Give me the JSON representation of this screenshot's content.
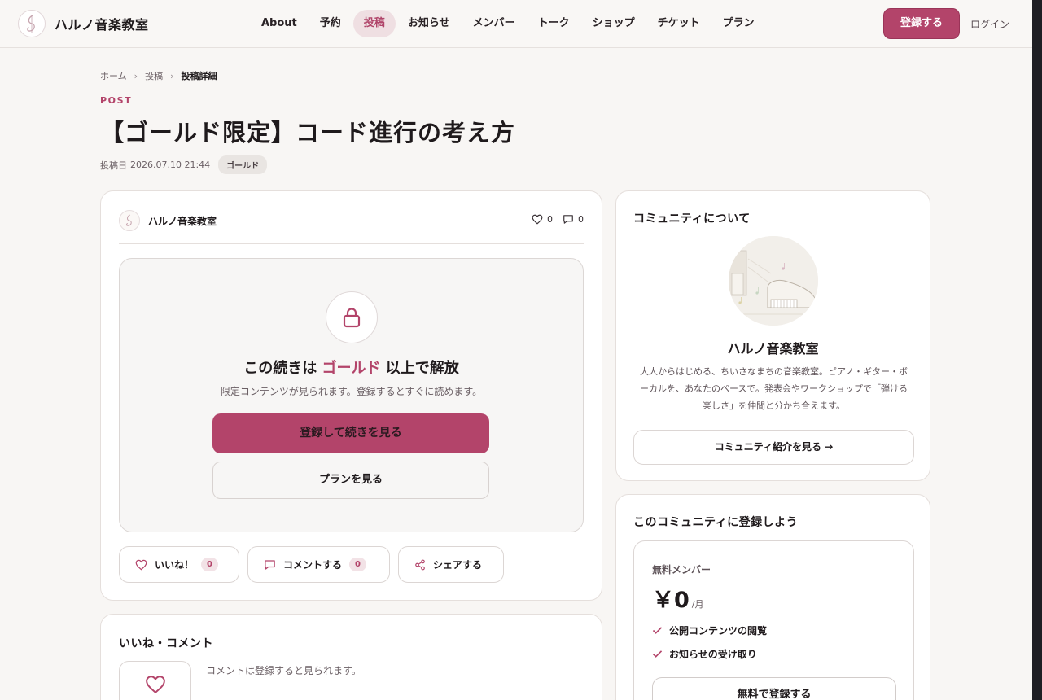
{
  "header": {
    "brand": "ハルノ音楽教室",
    "nav": [
      {
        "label": "About"
      },
      {
        "label": "予約"
      },
      {
        "label": "投稿"
      },
      {
        "label": "お知らせ"
      },
      {
        "label": "メンバー"
      },
      {
        "label": "トーク"
      },
      {
        "label": "ショップ"
      },
      {
        "label": "チケット"
      },
      {
        "label": "プラン"
      }
    ],
    "active_nav": "投稿",
    "register_label": "登録する",
    "login_label": "ログイン"
  },
  "breadcrumb": {
    "items": [
      "ホーム",
      "投稿",
      "投稿詳細"
    ],
    "separator": "›"
  },
  "post": {
    "section_label": "POST",
    "title": "【ゴールド限定】コード進行の考え方",
    "date_label": "投稿日",
    "date": "2026.07.10 21:44",
    "badge": "ゴールド",
    "author": "ハルノ音楽教室",
    "likes": "0",
    "comments": "0"
  },
  "locked": {
    "title_prefix": "この続きは",
    "title_accent": "ゴールド",
    "title_suffix": "以上で解放",
    "description": "限定コンテンツが見られます。登録するとすぐに読めます。",
    "primary_button": "登録して続きを見る",
    "secondary_button": "プランを見る"
  },
  "actions": {
    "like_label": "いいね！",
    "like_count": "0",
    "comment_label": "コメントする",
    "comment_count": "0",
    "share_label": "シェアする"
  },
  "comments_section": {
    "title": "いいね・コメント",
    "note": "コメントは登録すると見られます。"
  },
  "about": {
    "title": "コミュニティについて",
    "name": "ハルノ音楽教室",
    "description": "大人からはじめる、ちいさなまちの音楽教室。ピアノ・ギター・ボーカルを、あなたのペースで。発表会やワークショップで「弾ける楽しさ」を仲間と分かち合えます。",
    "button": "コミュニティ紹介を見る →"
  },
  "join": {
    "title": "このコミュニティに登録しよう",
    "plan_name": "無料メンバー",
    "price": "￥0",
    "price_unit": "/月",
    "features": [
      "公開コンテンツの閲覧",
      "お知らせの受け取り"
    ],
    "button": "無料で登録する"
  },
  "colors": {
    "accent": "#b3446a",
    "accent_soft": "#efdfe2",
    "background": "#f8f6f4"
  },
  "icons": [
    "logo-icon",
    "heart-icon",
    "comment-icon",
    "lock-icon",
    "share-icon",
    "check-icon"
  ]
}
